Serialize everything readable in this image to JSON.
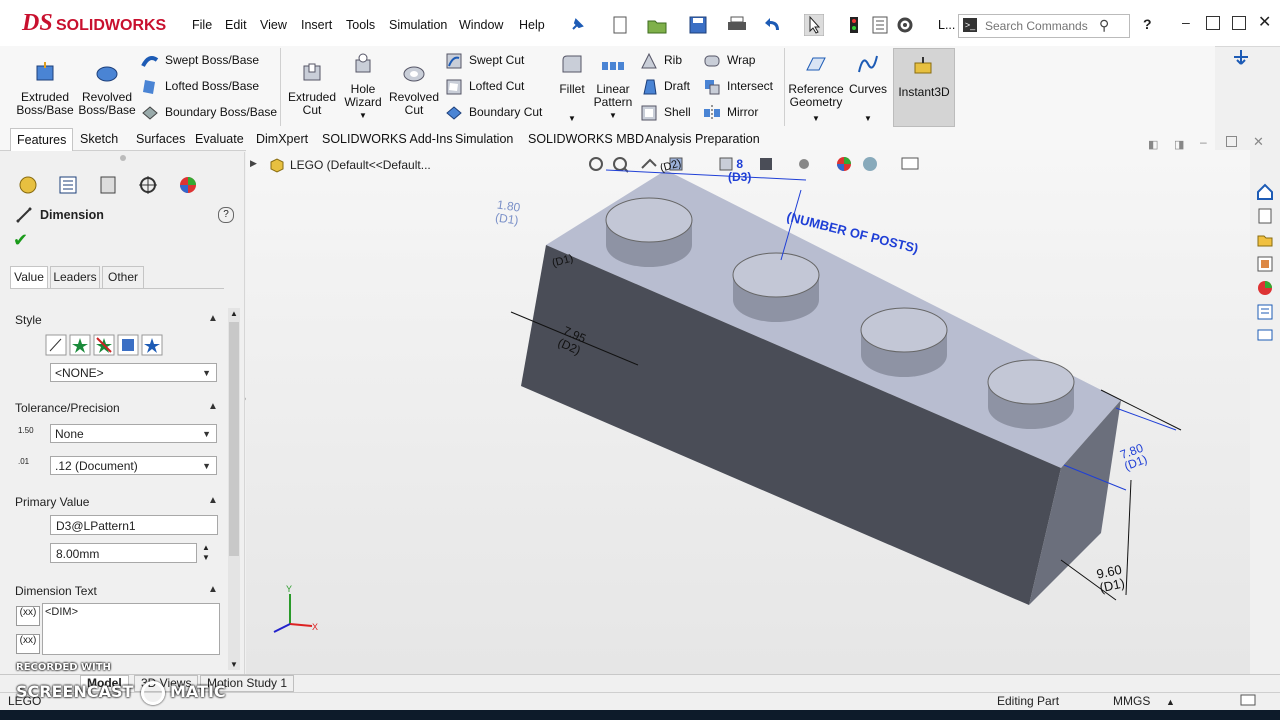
{
  "app": {
    "brand": "SOLIDWORKS",
    "brand_prefix": "DS"
  },
  "menu": [
    "File",
    "Edit",
    "View",
    "Insert",
    "Tools",
    "Simulation",
    "Window",
    "Help"
  ],
  "titlebar": {
    "doc_short": "L...",
    "search_placeholder": "Search Commands",
    "help": "?"
  },
  "ribbon": {
    "big": [
      {
        "label1": "Extruded",
        "label2": "Boss/Base"
      },
      {
        "label1": "Revolved",
        "label2": "Boss/Base"
      },
      {
        "label1": "Extruded",
        "label2": "Cut"
      },
      {
        "label1": "Hole",
        "label2": "Wizard"
      },
      {
        "label1": "Revolved",
        "label2": "Cut"
      },
      {
        "label1": "Fillet",
        "label2": ""
      },
      {
        "label1": "Linear",
        "label2": "Pattern"
      },
      {
        "label1": "Reference",
        "label2": "Geometry"
      },
      {
        "label1": "Curves",
        "label2": ""
      },
      {
        "label1": "Instant3D",
        "label2": ""
      }
    ],
    "small": [
      "Swept Boss/Base",
      "Lofted Boss/Base",
      "Boundary Boss/Base",
      "Swept Cut",
      "Lofted Cut",
      "Boundary Cut",
      "Rib",
      "Draft",
      "Shell",
      "Wrap",
      "Intersect",
      "Mirror"
    ]
  },
  "tabs": [
    "Features",
    "Sketch",
    "Surfaces",
    "Evaluate",
    "DimXpert",
    "SOLIDWORKS Add-Ins",
    "Simulation",
    "SOLIDWORKS MBD",
    "Analysis Preparation"
  ],
  "tree": {
    "root": "LEGO  (Default<<Default..."
  },
  "panel": {
    "title": "Dimension",
    "subtabs": [
      "Value",
      "Leaders",
      "Other"
    ],
    "style": {
      "header": "Style",
      "value": "<NONE>"
    },
    "tolerance": {
      "header": "Tolerance/Precision",
      "type": "None",
      "precision": ".12 (Document)",
      "icon1": "1.50",
      "icon2": ".01"
    },
    "primary": {
      "header": "Primary Value",
      "name": "D3@LPattern1",
      "value": "8.00mm"
    },
    "dimtext": {
      "header": "Dimension Text",
      "value": "<DIM>"
    }
  },
  "viewport": {
    "dims": [
      {
        "v": "1.80",
        "n": "(D1)"
      },
      {
        "v": "7.95",
        "n": "(D2)"
      },
      {
        "v": "8",
        "n": "(D3)"
      },
      {
        "v": "(NUMBER OF POSTS)",
        "n": ""
      },
      {
        "v": "7.80",
        "n": "(D1)"
      },
      {
        "v": "9.60",
        "n": "(D1)"
      },
      {
        "v": "(D1)",
        "n": ""
      },
      {
        "v": "(D2)",
        "n": ""
      }
    ],
    "triad": {
      "x": "X",
      "y": "Y"
    }
  },
  "bottom_tabs": [
    "Model",
    "3D Views",
    "Motion Study 1"
  ],
  "status": {
    "part": "LEGO",
    "mode": "Editing Part",
    "units": "MMGS"
  },
  "watermark": {
    "line1": "RECORDED WITH",
    "line2": "SCREENCAST",
    "line3": "MATIC"
  },
  "colors": {
    "brand": "#c8102e",
    "dim_blue": "#1f3fd6",
    "body_top": "#b8bdd0",
    "body_side": "#4a4d57"
  }
}
